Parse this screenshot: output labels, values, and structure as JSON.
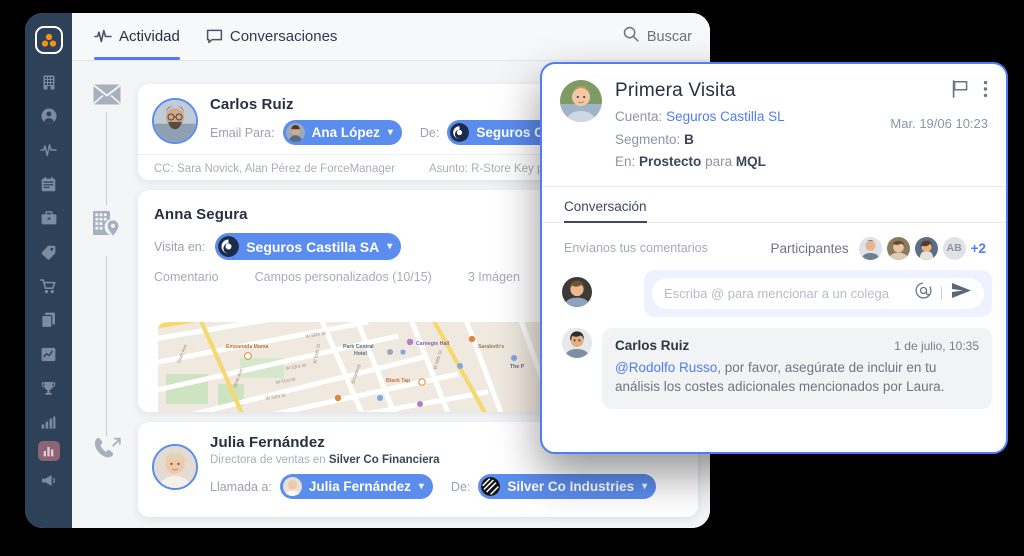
{
  "theme": {
    "sidebar_bg": "#2d4159",
    "accent_blue": "#4f7cf7",
    "chip_blue": "#5b8def",
    "logo_orange": "#f5921e",
    "page_bg": "#000000"
  },
  "sidebar": {
    "logo_name": "forcemanager-logo",
    "items": [
      {
        "name": "sidebar-item-companies",
        "icon": "building-icon",
        "active": false
      },
      {
        "name": "sidebar-item-contacts",
        "icon": "user-circle-icon",
        "active": false
      },
      {
        "name": "sidebar-item-activity",
        "icon": "activity-pulse-icon",
        "active": false
      },
      {
        "name": "sidebar-item-calendar",
        "icon": "calendar-icon",
        "active": false
      },
      {
        "name": "sidebar-item-opportunities",
        "icon": "briefcase-icon",
        "active": false
      },
      {
        "name": "sidebar-item-products",
        "icon": "tag-icon",
        "active": false
      },
      {
        "name": "sidebar-item-orders",
        "icon": "cart-icon",
        "active": false
      },
      {
        "name": "sidebar-item-documents",
        "icon": "documents-icon",
        "active": false
      },
      {
        "name": "sidebar-item-analytics",
        "icon": "chart-line-icon",
        "active": false
      },
      {
        "name": "sidebar-item-goals",
        "icon": "trophy-icon",
        "active": false
      },
      {
        "name": "sidebar-item-reports",
        "icon": "bar-chart-icon",
        "active": false
      },
      {
        "name": "sidebar-item-dashboard",
        "icon": "dashboard-icon",
        "active": true
      },
      {
        "name": "sidebar-item-news",
        "icon": "megaphone-icon",
        "active": false
      }
    ]
  },
  "topbar": {
    "tabs": [
      {
        "label": "Actividad",
        "icon": "activity-pulse-icon",
        "active": true
      },
      {
        "label": "Conversaciones",
        "icon": "chat-bubble-icon",
        "active": false
      }
    ],
    "search": {
      "icon": "search-icon",
      "label": "Buscar",
      "placeholder": "Buscar"
    }
  },
  "timeline": {
    "icons": [
      "envelope-icon",
      "building-location-icon",
      "phone-outgoing-icon"
    ]
  },
  "cards": {
    "email": {
      "type_icon": "envelope-icon",
      "person": "Carlos Ruiz",
      "to_label": "Email Para:",
      "to_chip": "Ana López",
      "from_label": "De:",
      "from_chip": "Seguros Cast",
      "cc": "CC: Sara Novick, Alan Pérez de ForceManager",
      "subject": "Asunto: R-Store Key p"
    },
    "visit": {
      "type_icon": "building-location-icon",
      "person": "Anna Segura",
      "at_label": "Visita en:",
      "at_chip": "Seguros Castilla SA",
      "subtabs": [
        "Comentario",
        "Campos personalizados (10/15)",
        "3 Imágen"
      ],
      "map": {
        "pin_icon": "map-pin-icon",
        "labels": [
          "W 56th St",
          "W 55th St",
          "W 53rd St",
          "W 52nd St",
          "W 51st St",
          "W 50th St",
          "Tenth Ave",
          "Ninth Ave",
          "Broadway",
          "Empanada Mama",
          "Park Central Hotel",
          "Carnegie Hall",
          "Sarabeth's",
          "Black Tap",
          "The P"
        ]
      }
    },
    "call": {
      "type_icon": "phone-outgoing-icon",
      "person": "Julia Fernández",
      "role_prefix": "Directora de ventas en ",
      "role_company": "Silver Co Financiera",
      "to_label": "Llamada a:",
      "to_chip": "Julia Fernández",
      "from_label": "De:",
      "from_chip": "Silver Co Industries"
    }
  },
  "panel": {
    "title": "Primera Visita",
    "flag_icon": "flag-icon",
    "menu_icon": "more-vertical-icon",
    "date": "Mar. 19/06 10:23",
    "fields": [
      {
        "label": "Cuenta:",
        "value": "Seguros Castilla SL",
        "style": "link"
      },
      {
        "label": "Segmento:",
        "value": "B",
        "style": "bold"
      }
    ],
    "stage_label": "En:",
    "stage_from": "Prostecto",
    "stage_mid": "para",
    "stage_to": "MQL",
    "tab": "Conversación",
    "comment_hint": "Envíanos tus comentarios",
    "participants_label": "Participantes",
    "participants_initials": "AB",
    "participants_more": "+2",
    "composer": {
      "placeholder": "Escriba @ para mencionar a un colega",
      "mention_icon": "at-sign-icon",
      "send_icon": "send-icon"
    },
    "comment": {
      "author": "Carlos Ruiz",
      "time": "1 de julio, 10:35",
      "mention": "@Rodolfo Russo",
      "text": ", por favor, asegúrate de incluir en tu análisis los costes adicionales mencionados por Laura."
    }
  }
}
